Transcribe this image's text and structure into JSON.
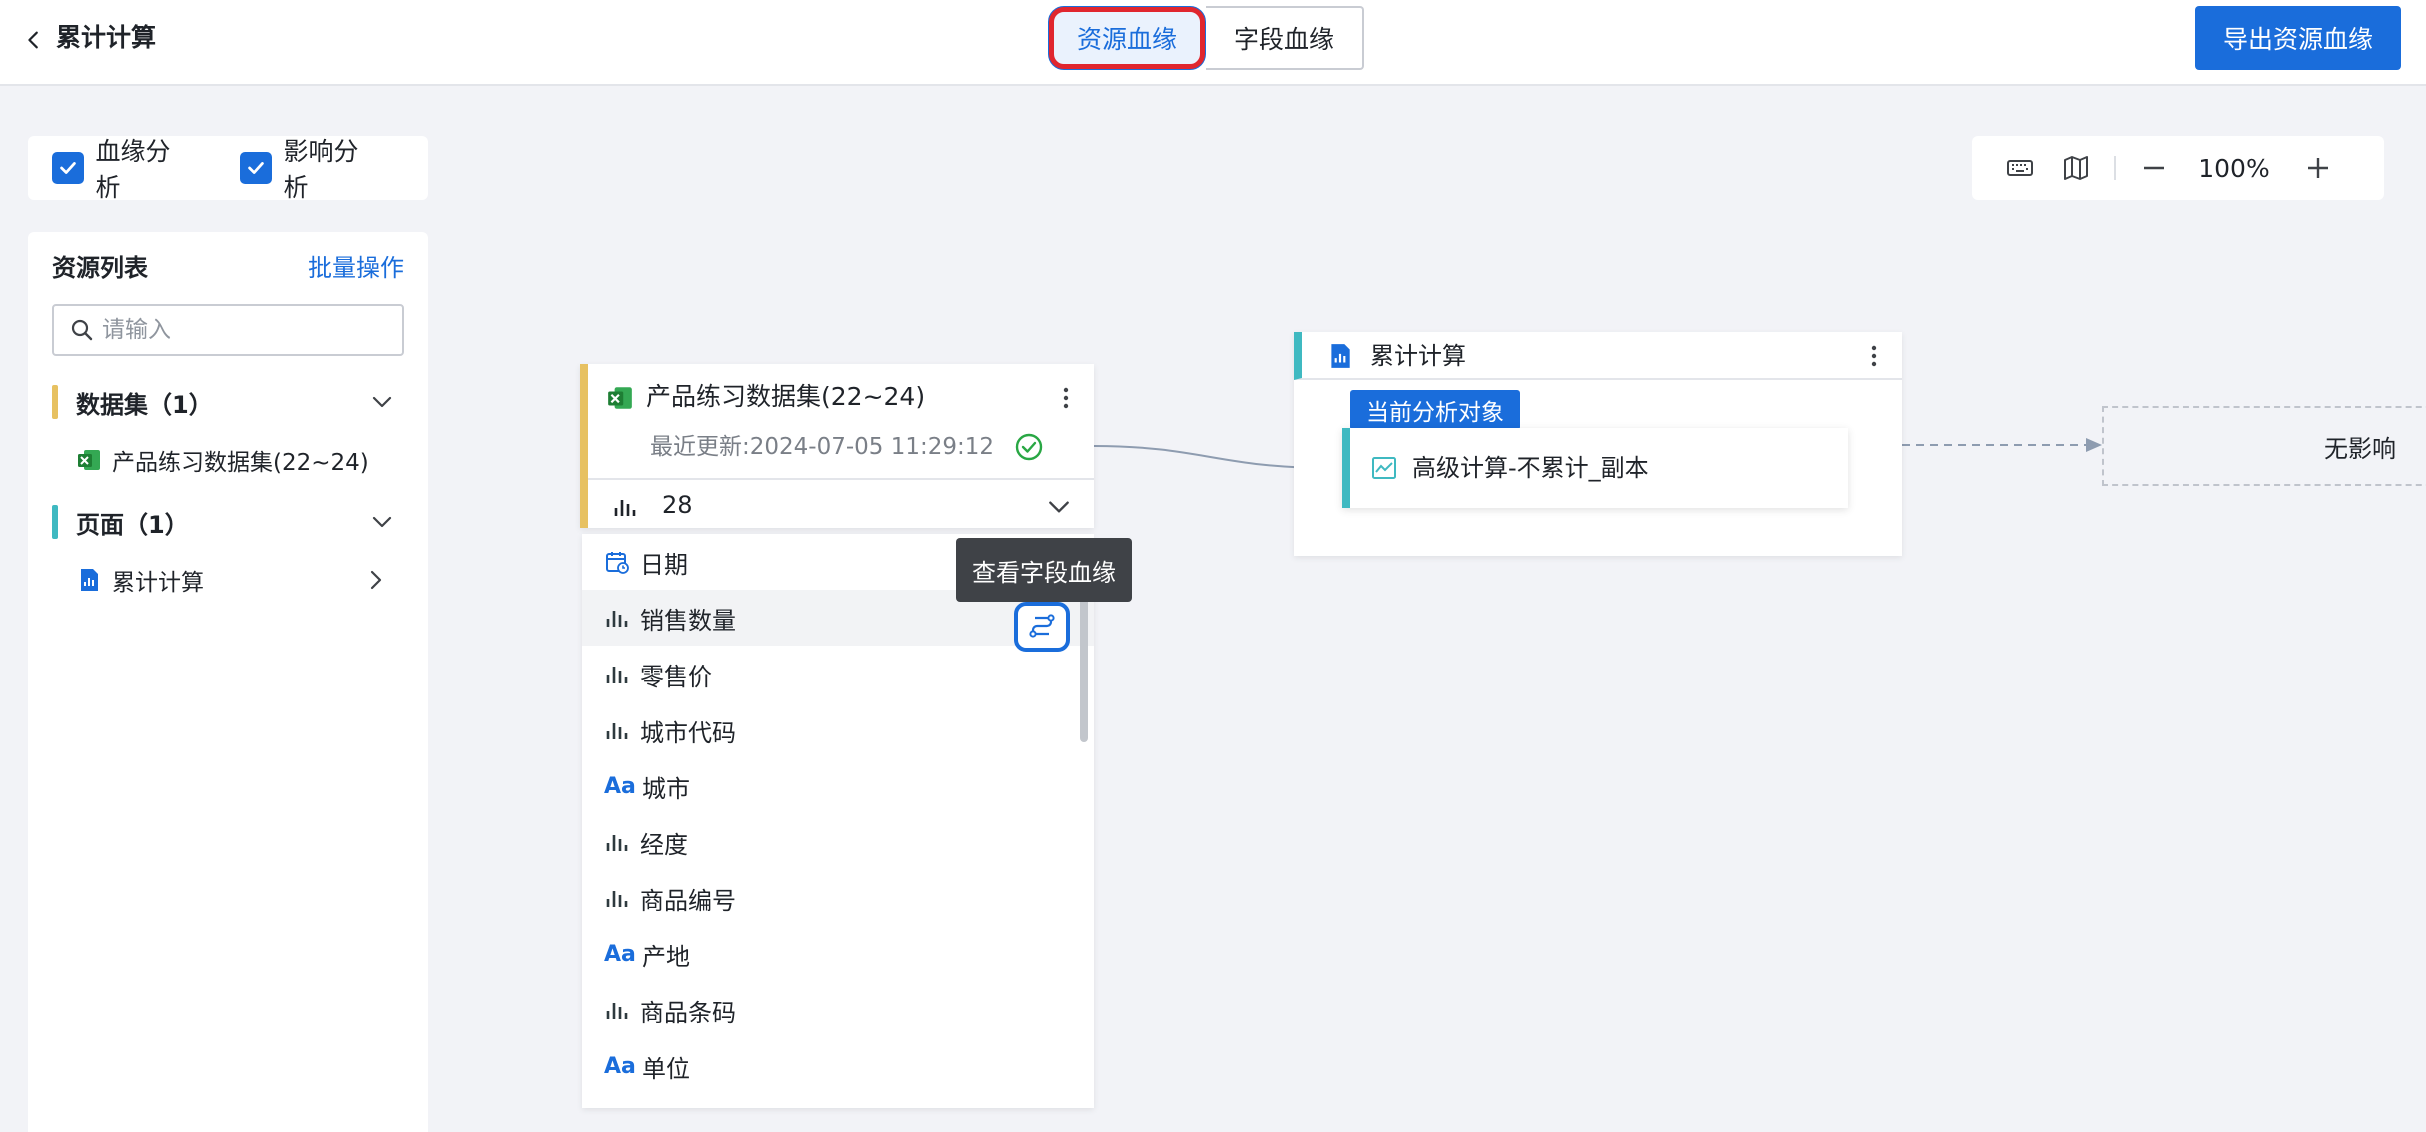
{
  "header": {
    "title": "累计计算",
    "tabs": [
      {
        "label": "资源血缘",
        "active": true
      },
      {
        "label": "字段血缘",
        "active": false
      }
    ],
    "export_label": "导出资源血缘"
  },
  "analysis_options": [
    {
      "label": "血缘分析",
      "checked": true
    },
    {
      "label": "影响分析",
      "checked": true
    }
  ],
  "zoom": {
    "value": "100%"
  },
  "sidebar": {
    "title": "资源列表",
    "batch_label": "批量操作",
    "search_placeholder": "请输入",
    "groups": [
      {
        "label": "数据集（1）",
        "color": "#e7c161",
        "items": [
          {
            "label": "产品练习数据集(22~24)",
            "icon": "excel-icon"
          }
        ]
      },
      {
        "label": "页面（1）",
        "color": "#3fb9c1",
        "items": [
          {
            "label": "累计计算",
            "icon": "page-report-icon"
          }
        ]
      }
    ]
  },
  "dataset_node": {
    "title": "产品练习数据集(22~24)",
    "updated": "最近更新:2024-07-05 11:29:12",
    "field_count": "28",
    "fields": [
      {
        "label": "日期",
        "type": "date"
      },
      {
        "label": "销售数量",
        "type": "measure"
      },
      {
        "label": "零售价",
        "type": "measure"
      },
      {
        "label": "城市代码",
        "type": "measure"
      },
      {
        "label": "城市",
        "type": "text"
      },
      {
        "label": "经度",
        "type": "measure"
      },
      {
        "label": "商品编号",
        "type": "measure"
      },
      {
        "label": "产地",
        "type": "text"
      },
      {
        "label": "商品条码",
        "type": "measure"
      },
      {
        "label": "单位",
        "type": "text"
      }
    ],
    "tooltip": "查看字段血缘"
  },
  "page_node": {
    "title": "累计计算",
    "badge": "当前分析对象",
    "chart_title": "高级计算-不累计_副本"
  },
  "no_impact_label": "无影响",
  "colors": {
    "accent": "#1a6ddb",
    "dataset": "#e7c161",
    "page": "#3fb9c1",
    "highlight": "#e0262e"
  }
}
